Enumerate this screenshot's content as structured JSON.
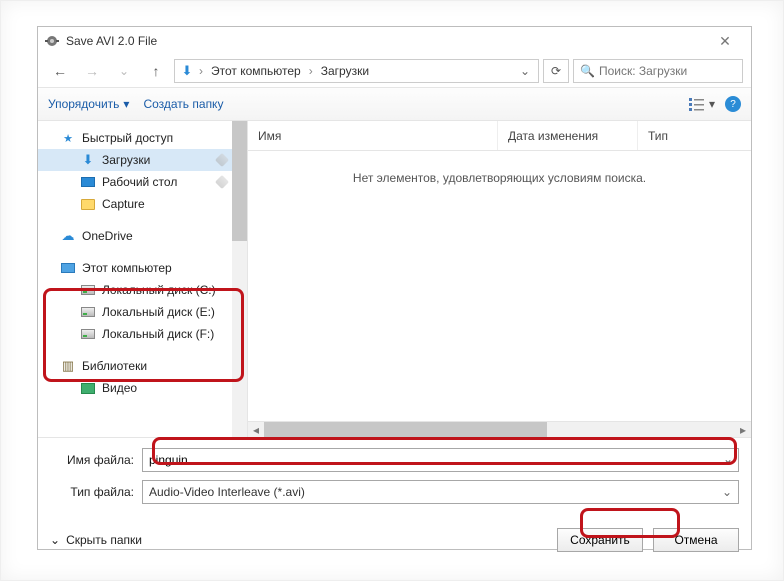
{
  "window": {
    "title": "Save AVI 2.0 File"
  },
  "nav": {
    "breadcrumb": {
      "root_label": "Этот компьютер",
      "current": "Загрузки"
    },
    "search_placeholder": "Поиск: Загрузки"
  },
  "toolbar": {
    "organize": "Упорядочить",
    "new_folder": "Создать папку"
  },
  "sidebar": {
    "quick_access": "Быстрый доступ",
    "downloads": "Загрузки",
    "desktop": "Рабочий стол",
    "capture": "Capture",
    "onedrive": "OneDrive",
    "this_pc": "Этот компьютер",
    "drive_c": "Локальный диск (C:)",
    "drive_e": "Локальный диск (E:)",
    "drive_f": "Локальный диск (F:)",
    "libraries": "Библиотеки",
    "videos": "Видео"
  },
  "columns": {
    "name": "Имя",
    "date": "Дата изменения",
    "type": "Тип"
  },
  "list": {
    "empty": "Нет элементов, удовлетворяющих условиям поиска."
  },
  "form": {
    "filename_label": "Имя файла:",
    "filename_value": "pinguin",
    "filetype_label": "Тип файла:",
    "filetype_value": "Audio-Video Interleave (*.avi)"
  },
  "footer": {
    "hide_folders": "Скрыть папки",
    "save": "Сохранить",
    "cancel": "Отмена"
  }
}
